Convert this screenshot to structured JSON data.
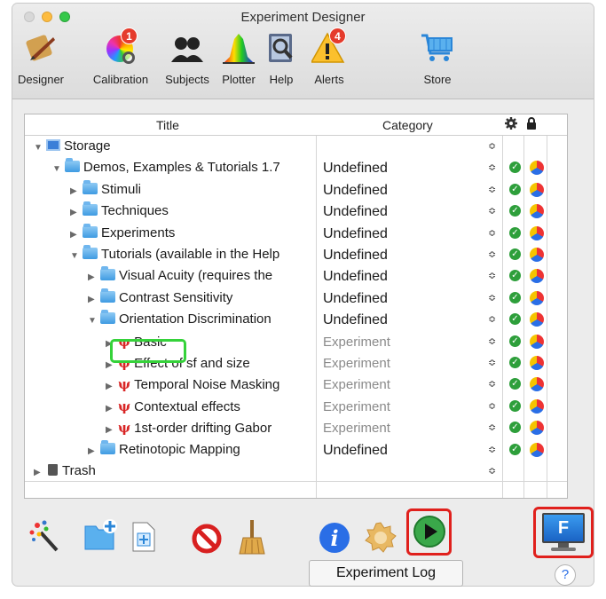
{
  "window": {
    "title": "Experiment Designer"
  },
  "toolbar": {
    "items": [
      {
        "label": "Designer"
      },
      {
        "label": "Calibration",
        "badge": "1"
      },
      {
        "label": "Subjects"
      },
      {
        "label": "Plotter"
      },
      {
        "label": "Help"
      },
      {
        "label": "Alerts",
        "badge": "4"
      },
      {
        "label": "Store"
      }
    ]
  },
  "outline": {
    "columns": {
      "title": "Title",
      "category": "Category"
    },
    "rows": [
      {
        "name": "Storage",
        "category": ""
      },
      {
        "name": "Demos, Examples & Tutorials 1.7",
        "category": "Undefined"
      },
      {
        "name": "Stimuli",
        "category": "Undefined"
      },
      {
        "name": "Techniques",
        "category": "Undefined"
      },
      {
        "name": "Experiments",
        "category": "Undefined"
      },
      {
        "name": "Tutorials (available in the Help",
        "category": "Undefined"
      },
      {
        "name": "Visual Acuity (requires the",
        "category": "Undefined"
      },
      {
        "name": "Contrast Sensitivity",
        "category": "Undefined"
      },
      {
        "name": "Orientation Discrimination",
        "category": "Undefined"
      },
      {
        "name": "Basic",
        "category": "Experiment"
      },
      {
        "name": "Effect of sf and size",
        "category": "Experiment"
      },
      {
        "name": "Temporal Noise Masking",
        "category": "Experiment"
      },
      {
        "name": "Contextual effects",
        "category": "Experiment"
      },
      {
        "name": "1st-order drifting Gabor",
        "category": "Experiment"
      },
      {
        "name": "Retinotopic Mapping",
        "category": "Undefined"
      },
      {
        "name": "Trash",
        "category": ""
      }
    ]
  },
  "bottom": {
    "log_label": "Experiment Log",
    "help_label": "?",
    "f_label": "F"
  },
  "colors": {
    "highlight_green": "#35d23a",
    "highlight_red": "#e0201c",
    "status_green": "#2e9f3b"
  }
}
